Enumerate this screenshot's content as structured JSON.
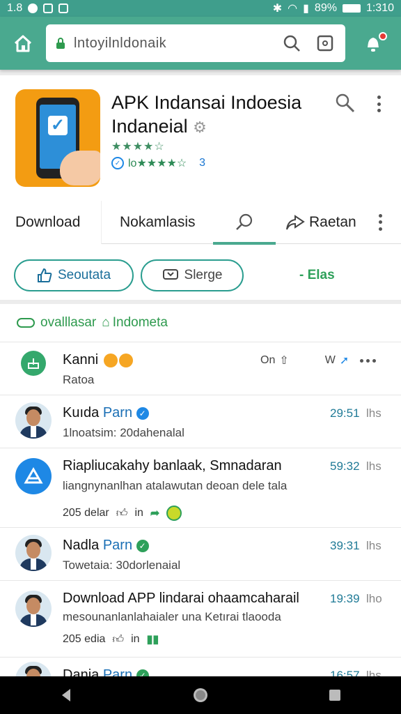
{
  "status": {
    "left_text": "1.8",
    "battery": "89%",
    "time": "1:310"
  },
  "toolbar": {
    "url": "lntoyilnldonaik"
  },
  "app": {
    "title_line1": "APK Indansai Indoesia",
    "title_line2": "Indaneial",
    "stars_row1": "★★★★☆",
    "rating_text": "lo★★★★☆",
    "rating_count": "3"
  },
  "tabs": {
    "download": "Download",
    "nok": "Nokamlasis",
    "rate": "Raetan"
  },
  "buttons": {
    "primary": "Seoutata",
    "secondary": "Slerge",
    "link": "- Elas"
  },
  "feed": {
    "header": "ovalllasar",
    "header2": "Indometa",
    "items": [
      {
        "name": "Kanni",
        "sub": "Ratoa",
        "action_left": "On",
        "action_right": "W"
      },
      {
        "name": "Kuıda",
        "name_blue": "Parn",
        "sub": "1lnoatsim: 20dahenalal",
        "time": "29:51",
        "unit": "lhs"
      },
      {
        "name": "Riapliucakahy banlaak, Smnadaran",
        "sub": "liangnynanlhan atalawutan deoan dele tala",
        "meta": "205 delar",
        "meta_in": "in",
        "time": "59:32",
        "unit": "lhs"
      },
      {
        "name": "Nadla",
        "name_blue": "Parn",
        "sub": "Towetaia: 30dorlenaial",
        "time": "39:31",
        "unit": "lhs"
      },
      {
        "name": "Download APP lindarai ohaamcaharail",
        "sub": "mesounanlanlahaialer una Ketırai tlaooda",
        "meta": "205 edia",
        "meta_in": "in",
        "time": "19:39",
        "unit": "lho"
      },
      {
        "name": "Dania",
        "name_blue": "Parn",
        "time": "16:57",
        "unit": "lhs"
      }
    ]
  },
  "colors": {
    "header": "#4aa98f",
    "accent_blue": "#1e88e5",
    "accent_green": "#2ea05a"
  }
}
